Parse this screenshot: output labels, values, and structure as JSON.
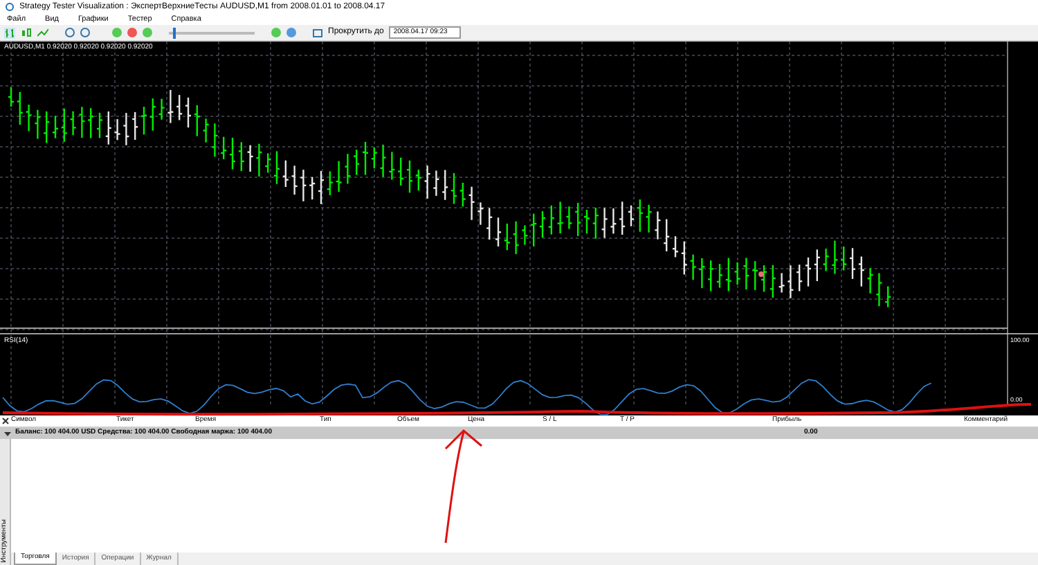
{
  "window": {
    "title": "Strategy Tester Visualization : ЭкспертВерхниеТесты AUDUSD,M1 from 2008.01.01 to 2008.04.17"
  },
  "menu": [
    "Файл",
    "Вид",
    "Графики",
    "Тестер",
    "Справка"
  ],
  "toolbar": {
    "scroll_label": "Прокрутить до",
    "date_value": "2008.04.17 09:23",
    "speed_slider": {
      "level": 0.05
    }
  },
  "chart": {
    "symbol_info": "AUDUSD,M1  0.92020 0.92020 0.92020 0.92020",
    "indicator_label": "RSI(14)",
    "indicator_ticks": [
      "100.00",
      "0.00"
    ]
  },
  "trade_table": {
    "columns": [
      "Символ",
      "Тикет",
      "Время",
      "Тип",
      "Объем",
      "Цена",
      "S / L",
      "T / P",
      "Прибыль",
      "Комментарий"
    ],
    "balance_row": {
      "text": "Баланс: 100 404.00 USD  Средства: 100 404.00  Свободная маржа: 100 404.00",
      "profit": "0.00",
      "expanded": true
    }
  },
  "side_label": "Инструменты",
  "tabs": [
    {
      "label": "Торговля",
      "selected": true
    },
    {
      "label": "История",
      "selected": false
    },
    {
      "label": "Операции",
      "selected": false
    },
    {
      "label": "Журнал",
      "selected": false
    }
  ]
}
